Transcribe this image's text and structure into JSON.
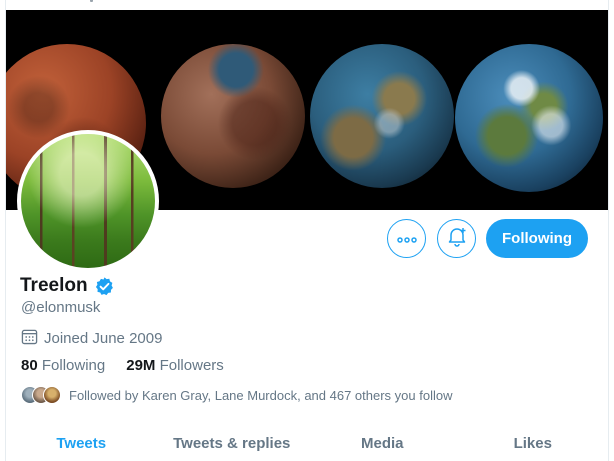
{
  "profile": {
    "display_name": "Treelon",
    "handle": "@elonmusk",
    "joined": "Joined June 2009",
    "following_count": "80",
    "following_label": "Following",
    "followers_count": "29M",
    "followers_label": "Followers",
    "followed_by": "Followed by Karen Gray, Lane Murdock, and 467 others you follow"
  },
  "actions": {
    "follow_label": "Following"
  },
  "tabs": [
    {
      "label": "Tweets",
      "active": true
    },
    {
      "label": "Tweets & replies",
      "active": false
    },
    {
      "label": "Media",
      "active": false
    },
    {
      "label": "Likes",
      "active": false
    }
  ],
  "colors": {
    "accent": "#1da1f2",
    "text_primary": "#14171a",
    "text_secondary": "#657786"
  },
  "icons": {
    "more": "more-icon",
    "notify": "bell-plus-icon",
    "verified": "verified-badge-icon",
    "calendar": "calendar-icon"
  }
}
